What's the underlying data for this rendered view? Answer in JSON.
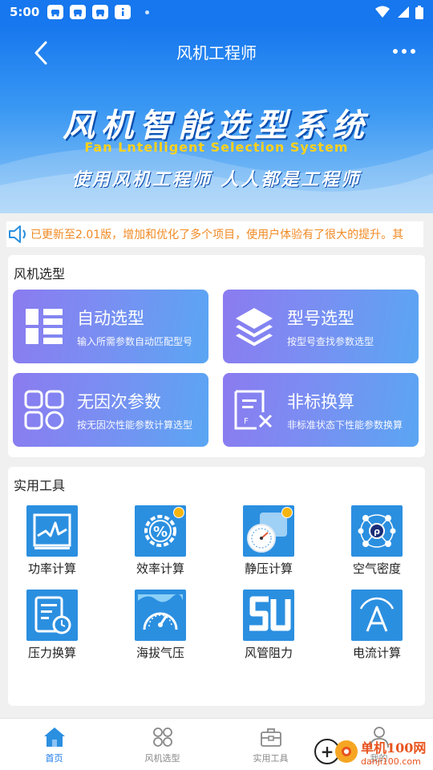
{
  "status_bar": {
    "time": "5:00",
    "notification_icons": [
      "car-icon",
      "car-icon",
      "car-icon",
      "info-icon"
    ],
    "system_icons": [
      "wifi-icon",
      "signal-icon",
      "battery-icon"
    ]
  },
  "nav": {
    "title": "风机工程师",
    "back_icon": "chevron-left-icon",
    "more_icon": "more-dots-icon"
  },
  "banner": {
    "title": "风机智能选型系统",
    "subtitle": "Fan Lntelligent Selection System",
    "slogan": "使用风机工程师  人人都是工程师"
  },
  "notice": {
    "icon": "speaker-icon",
    "text": "已更新至2.01版，增加和优化了多个项目，使用户体验有了很大的提升。其"
  },
  "fan_selection": {
    "title": "风机选型",
    "items": [
      {
        "title": "自动选型",
        "desc": "输入所需参数自动匹配型号",
        "icon": "list-grid-icon"
      },
      {
        "title": "型号选型",
        "desc": "按型号查找参数选型",
        "icon": "layers-icon"
      },
      {
        "title": "无因次参数",
        "desc": "按无因次性能参数计算选型",
        "icon": "squares-circle-icon"
      },
      {
        "title": "非标换算",
        "desc": "非标准状态下性能参数换算",
        "icon": "document-x-icon"
      }
    ]
  },
  "tools": {
    "title": "实用工具",
    "items": [
      {
        "label": "功率计算",
        "icon": "power-chart-icon",
        "color": "#2b8fe0"
      },
      {
        "label": "效率计算",
        "icon": "percent-gear-icon",
        "color": "#2b8fe0"
      },
      {
        "label": "静压计算",
        "icon": "pressure-gauge-icon",
        "color": "#2b8fe0"
      },
      {
        "label": "空气密度",
        "icon": "molecule-icon",
        "color": "#2b8fe0"
      },
      {
        "label": "压力换算",
        "icon": "form-clock-icon",
        "color": "#2b8fe0"
      },
      {
        "label": "海拔气压",
        "icon": "altitude-gauge-icon",
        "color": "#2b8fe0"
      },
      {
        "label": "风管阻力",
        "icon": "duct-su-icon",
        "color": "#2b8fe0"
      },
      {
        "label": "电流计算",
        "icon": "current-a-icon",
        "color": "#2b8fe0"
      }
    ]
  },
  "tabbar": {
    "items": [
      {
        "label": "首页",
        "icon": "home-icon",
        "active": true
      },
      {
        "label": "风机选型",
        "icon": "four-circles-icon",
        "active": false
      },
      {
        "label": "实用工具",
        "icon": "toolbox-icon",
        "active": false
      },
      {
        "label": "我的",
        "icon": "user-icon",
        "active": false
      }
    ]
  },
  "watermark": {
    "main": "单机100网",
    "sub": "danji100.com"
  },
  "colors": {
    "primary": "#1677ee",
    "notice_text": "#f08a24",
    "card_gradient_start": "#8b7bf0",
    "card_gradient_end": "#5aa6f3",
    "banner_subtitle": "#ffd21a"
  }
}
